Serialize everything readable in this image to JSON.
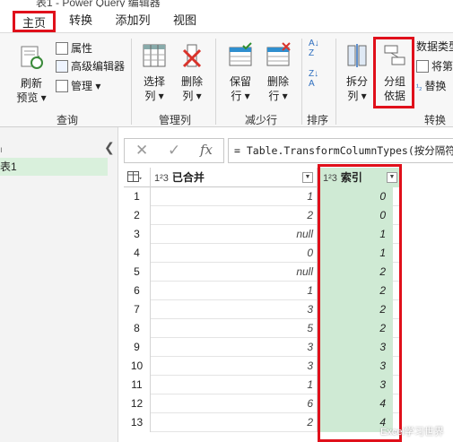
{
  "window": {
    "title_fragment": "表1 - Power Query 编辑器"
  },
  "tabs": [
    {
      "label": "主页",
      "active": true
    },
    {
      "label": "转换",
      "active": false
    },
    {
      "label": "添加列",
      "active": false
    },
    {
      "label": "视图",
      "active": false
    }
  ],
  "ribbon": {
    "query": {
      "refresh_label": "刷新\n预览",
      "refresh_line1": "刷新",
      "refresh_line2": "预览 ▾",
      "properties_label": "属性",
      "advanced_editor_label": "高级编辑器",
      "manage_label": "管理 ▾",
      "group_label": "查询"
    },
    "manage_columns": {
      "choose_line1": "选择",
      "choose_line2": "列 ▾",
      "remove_line1": "删除",
      "remove_line2": "列 ▾",
      "group_label": "管理列"
    },
    "reduce_rows": {
      "keep_line1": "保留",
      "keep_line2": "行 ▾",
      "remove_line1": "删除",
      "remove_line2": "行 ▾",
      "group_label": "减少行"
    },
    "sort": {
      "group_label": "排序"
    },
    "transform": {
      "split_line1": "拆分",
      "split_line2": "列 ▾",
      "groupby_line1": "分组",
      "groupby_line2": "依据",
      "datatype_label": "数据类型",
      "use_first_row_label": "将第",
      "replace_label": "替换",
      "group_label": "转换"
    }
  },
  "left_pane": {
    "collapse_icon": "chevron-left-icon",
    "query_item": "表1"
  },
  "formula_bar": {
    "cancel_glyph": "✕",
    "confirm_glyph": "✓",
    "fx_glyph": "fx",
    "formula": "= Table.TransformColumnTypes(按分隔符拆"
  },
  "grid": {
    "columns": [
      {
        "type_glyph": "1²3",
        "name": "已合并"
      },
      {
        "type_glyph": "1²3",
        "name": "索引"
      }
    ],
    "rows": [
      {
        "n": "1",
        "merged": "1",
        "index": "0"
      },
      {
        "n": "2",
        "merged": "2",
        "index": "0"
      },
      {
        "n": "3",
        "merged": "null",
        "index": "1"
      },
      {
        "n": "4",
        "merged": "0",
        "index": "1"
      },
      {
        "n": "5",
        "merged": "null",
        "index": "2"
      },
      {
        "n": "6",
        "merged": "1",
        "index": "2"
      },
      {
        "n": "7",
        "merged": "3",
        "index": "2"
      },
      {
        "n": "8",
        "merged": "5",
        "index": "2"
      },
      {
        "n": "9",
        "merged": "3",
        "index": "3"
      },
      {
        "n": "10",
        "merged": "3",
        "index": "3"
      },
      {
        "n": "11",
        "merged": "1",
        "index": "3"
      },
      {
        "n": "12",
        "merged": "6",
        "index": "4"
      },
      {
        "n": "13",
        "merged": "2",
        "index": "4"
      }
    ]
  },
  "watermark": "Excel学习世界",
  "colors": {
    "highlight_red": "#e0101b",
    "selected_green": "#cfead4",
    "ribbon_bg": "#f7f7f7"
  }
}
